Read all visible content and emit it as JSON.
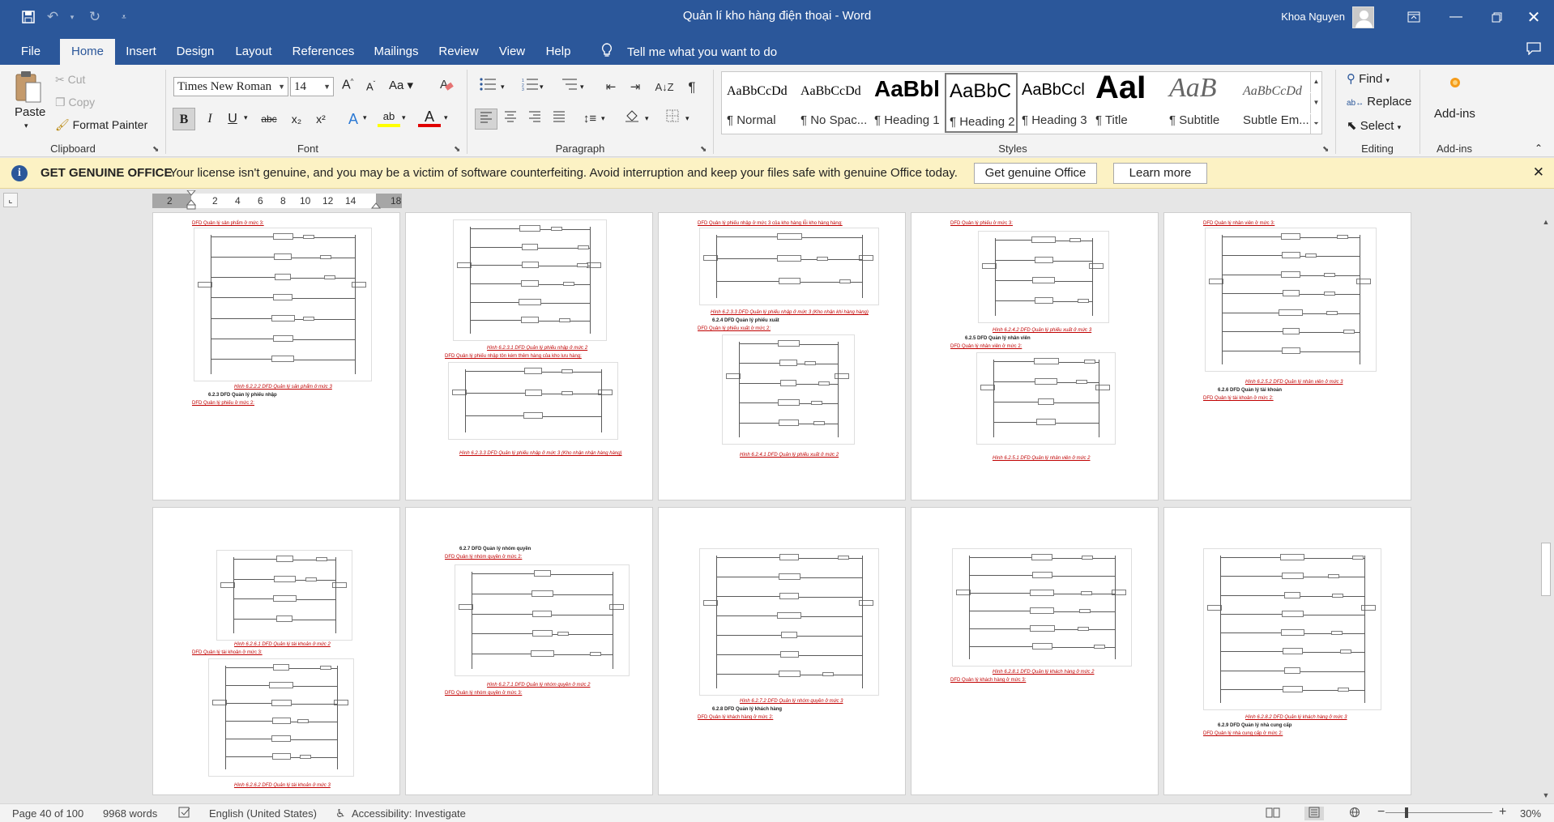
{
  "window": {
    "title": "Quản lí kho hàng điện thoại  -  Word",
    "user": "Khoa Nguyen"
  },
  "colors": {
    "accent": "#2b579a",
    "ribbon_bg": "#f3f3f3",
    "infobar_bg": "#fcf2c4",
    "caption_red": "#c00000"
  },
  "quick_access": {
    "save_icon": "save-icon",
    "undo_icon": "undo-icon",
    "redo_icon": "redo-icon",
    "customize_icon": "chevron-down-icon"
  },
  "tabs": [
    {
      "label": "File"
    },
    {
      "label": "Home"
    },
    {
      "label": "Insert"
    },
    {
      "label": "Design"
    },
    {
      "label": "Layout"
    },
    {
      "label": "References"
    },
    {
      "label": "Mailings"
    },
    {
      "label": "Review"
    },
    {
      "label": "View"
    },
    {
      "label": "Help"
    }
  ],
  "active_tab": "Home",
  "tell_me": "Tell me what you want to do",
  "ribbon": {
    "clipboard": {
      "paste": "Paste",
      "cut": "Cut",
      "copy": "Copy",
      "format_painter": "Format Painter",
      "label": "Clipboard"
    },
    "font": {
      "name": "Times New Roman",
      "size": "14",
      "label": "Font",
      "grow_font": "A",
      "shrink_font": "A",
      "bold": "B",
      "italic": "I",
      "underline": "U",
      "strike": "abc",
      "subscript": "x₂",
      "superscript": "x²",
      "text_effects": "A",
      "highlight": "ab",
      "font_color": "A"
    },
    "paragraph": {
      "label": "Paragraph",
      "pilcrow": "¶"
    },
    "styles": {
      "label": "Styles",
      "items": [
        {
          "sample": "AaBbCcDd",
          "name": "¶ Normal"
        },
        {
          "sample": "AaBbCcDd",
          "name": "¶ No Spac..."
        },
        {
          "sample": "AaBbl",
          "name": "¶ Heading 1"
        },
        {
          "sample": "AaBbC",
          "name": "¶ Heading 2"
        },
        {
          "sample": "AaBbCcl",
          "name": "¶ Heading 3"
        },
        {
          "sample": "AaI",
          "name": "¶ Title"
        },
        {
          "sample": "AaB",
          "name": "¶ Subtitle"
        },
        {
          "sample": "AaBbCcDd",
          "name": "Subtle Em..."
        }
      ],
      "selected": "¶ Heading 2"
    },
    "editing": {
      "find": "Find",
      "replace": "Replace",
      "select": "Select",
      "label": "Editing"
    },
    "addins": {
      "button": "Add-ins",
      "label": "Add-ins"
    }
  },
  "infobar": {
    "title": "GET GENUINE OFFICE",
    "message": "Your license isn't genuine, and you may be a victim of software counterfeiting. Avoid interruption and keep your files safe with genuine Office today.",
    "btn_genuine": "Get genuine Office",
    "btn_learn": "Learn more"
  },
  "ruler": {
    "numbers": [
      "2",
      "2",
      "4",
      "6",
      "8",
      "10",
      "12",
      "14",
      "18"
    ]
  },
  "pages": {
    "row1": [
      {
        "top_text": "DFD Quản lý sản phẩm ở mức 3:",
        "caption": "Hình 6.2.2.2 DFD Quản lý sản phẩm ở mức 3",
        "heading": "6.2.3    DFD Quản lý phiếu nhập",
        "bottom_text": "DFD Quản lý phiếu ở mức 2:"
      },
      {
        "caption": "Hình 6.2.3.1 DFD Quản lý phiếu nhập ở mức 2",
        "mid_text": "DFD Quản lý phiếu nhập tôn kém thêm hàng của kho lưu hàng:",
        "caption2": "Hình 6.2.3.3 DFD Quản lý phiếu nhập ở mức 3 (Kho nhận nhận hàng hàng)"
      },
      {
        "top_text": "DFD Quản lý phiếu nhập ở mức 3 của kho hàng lỗi kho hàng hàng:",
        "caption": "Hình 6.2.3.3 DFD Quản lý phiếu nhập ở mức 3 (Kho nhận khi hàng hàng)",
        "heading": "6.2.4    DFD Quản lý phiếu xuất",
        "mid_text": "DFD Quản lý phiếu xuất ở mức 2:",
        "caption2": "Hình 6.2.4.1 DFD Quản lý phiếu xuất ở mức 2"
      },
      {
        "top_text": "DFD Quản lý phiếu ở mức 3:",
        "caption": "Hình 6.2.4.2 DFD Quản lý phiếu xuất ở mức 3",
        "heading": "6.2.5    DFD Quản lý nhân viên",
        "mid_text": "DFD Quản lý nhân viên ở mức 2:",
        "caption2": "Hình 6.2.5.1 DFD Quản lý nhân viên ở mức 2"
      },
      {
        "top_text": "DFD Quản lý nhân viên ở mức 3:",
        "caption": "Hình 6.2.5.2 DFD Quản lý nhân viên ở mức 3",
        "heading": "6.2.6    DFD Quản lý tài khoản",
        "bottom_text": "DFD Quản lý tài khoản ở mức 2:"
      }
    ],
    "row2": [
      {
        "caption": "Hình 6.2.6.1 DFD Quản lý tài khoản ở mức 2",
        "mid_text": "DFD Quản lý tài khoản ở mức 3:",
        "caption2": "Hình 6.2.6.2 DFD Quản lý tài khoản ở mức 3"
      },
      {
        "heading": "6.2.7    DFD Quản lý nhóm quyền",
        "top_text": "DFD Quản lý nhóm quyền ở mức 2:",
        "caption": "Hình 6.2.7.1 DFD Quản lý nhóm quyền ở mức 2",
        "bottom_text": "DFD Quản lý nhóm quyền ở mức 3:"
      },
      {
        "caption": "Hình 6.2.7.2 DFD Quản lý nhóm quyền ở mức 3",
        "heading": "6.2.8    DFD Quản lý khách hàng",
        "bottom_text": "DFD Quản lý khách hàng ở mức 2:"
      },
      {
        "caption": "Hình 6.2.8.1 DFD Quản lý khách hàng ở mức 2",
        "bottom_text": "DFD Quản lý khách hàng ở mức 3:"
      },
      {
        "caption": "Hình 6.2.8.2 DFD Quản lý khách hàng ở mức 3",
        "heading": "6.2.9    DFD Quản lý nhà cung cấp",
        "bottom_text": "DFD Quản lý nhà cung cấp ở mức 2:"
      }
    ]
  },
  "status": {
    "page": "Page 40 of 100",
    "words": "9968 words",
    "language": "English (United States)",
    "accessibility": "Accessibility: Investigate",
    "zoom": "30%",
    "zoom_minus": "−",
    "zoom_plus": "+"
  }
}
